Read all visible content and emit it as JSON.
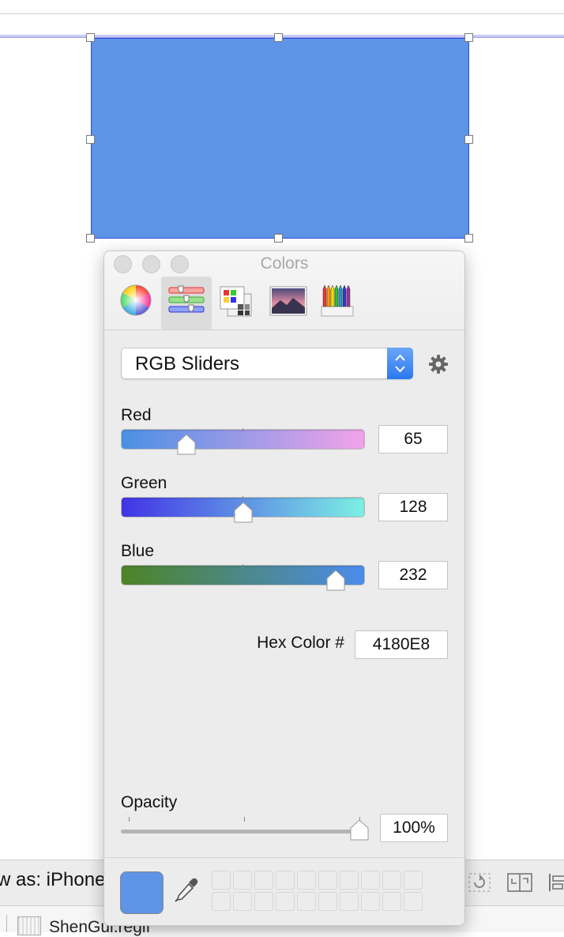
{
  "canvas": {
    "selected_view_color": "#5d94e6"
  },
  "colors_panel": {
    "title": "Colors",
    "mode_tabs": [
      {
        "name": "color-wheel",
        "selected": false
      },
      {
        "name": "color-sliders",
        "selected": true
      },
      {
        "name": "color-palettes",
        "selected": false
      },
      {
        "name": "image-palettes",
        "selected": false
      },
      {
        "name": "pencils",
        "selected": false
      }
    ],
    "slider_mode": {
      "selected": "RGB Sliders"
    },
    "sliders": {
      "red": {
        "label": "Red",
        "value": "65"
      },
      "green": {
        "label": "Green",
        "value": "128"
      },
      "blue": {
        "label": "Blue",
        "value": "232"
      }
    },
    "hex": {
      "label": "Hex Color #",
      "value": "4180E8"
    },
    "opacity": {
      "label": "Opacity",
      "value": "100%"
    },
    "current_color": "#5d94e6"
  },
  "interface_builder": {
    "view_as_label": "w as: iPhone",
    "file_name": "ShenGui.regif"
  }
}
